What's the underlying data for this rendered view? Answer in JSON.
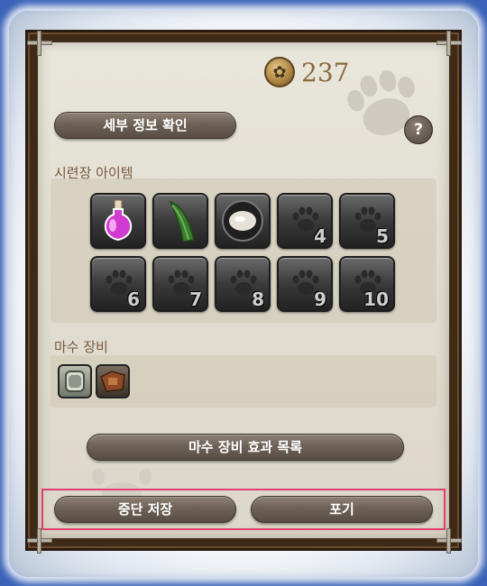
{
  "currency": {
    "amount": "237",
    "icon": "coin-icon"
  },
  "buttons": {
    "details": "세부 정보 확인",
    "help": "?",
    "equipment_effects": "마수 장비 효과 목록",
    "suspend_save": "중단 저장",
    "give_up": "포기"
  },
  "sections": {
    "trial_items": "시련장 아이템",
    "beast_equipment": "마수 장비"
  },
  "item_slots": [
    {
      "icon": "potion-icon",
      "number": ""
    },
    {
      "icon": "leaf-icon",
      "number": ""
    },
    {
      "icon": "salt-bowl-icon",
      "number": ""
    },
    {
      "icon": "paw-icon",
      "number": "4"
    },
    {
      "icon": "paw-icon",
      "number": "5"
    },
    {
      "icon": "paw-icon",
      "number": "6"
    },
    {
      "icon": "paw-icon",
      "number": "7"
    },
    {
      "icon": "paw-icon",
      "number": "8"
    },
    {
      "icon": "paw-icon",
      "number": "9"
    },
    {
      "icon": "paw-icon",
      "number": "10"
    }
  ],
  "equipment_slots": [
    {
      "icon": "bracer-icon"
    },
    {
      "icon": "saddle-icon"
    }
  ],
  "colors": {
    "accent_highlight": "#e04070",
    "label": "#7a5a3e"
  }
}
